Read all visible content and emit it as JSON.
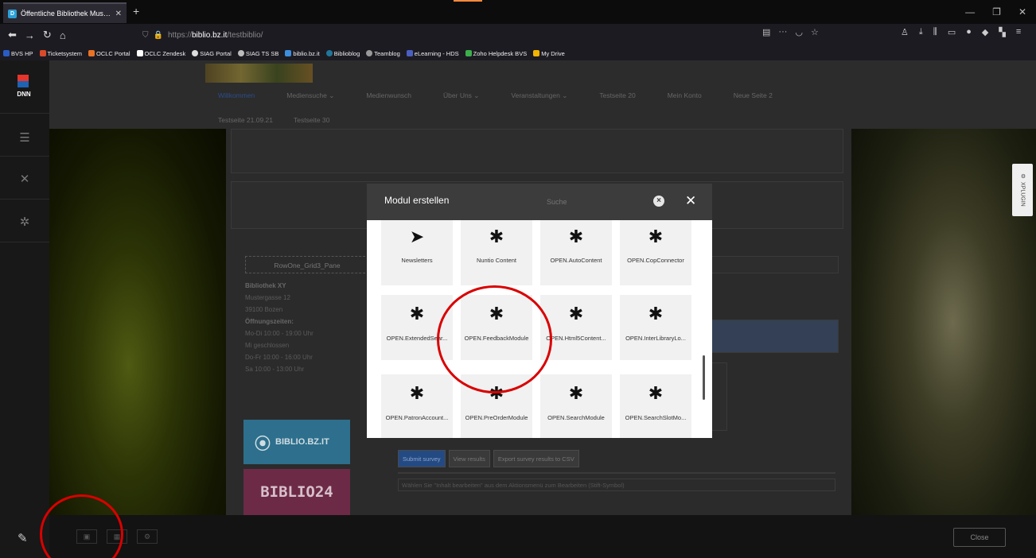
{
  "browser": {
    "tab_title": "Öffentliche Bibliothek Musterh",
    "tab_close": "✕",
    "new_tab": "+",
    "url_prefix": "https://",
    "url_domain": "biblio.bz.it",
    "url_path": "/testbiblio/",
    "page_actions": "···",
    "bookmarks": [
      "BVS HP",
      "Ticketsystem",
      "OCLC Portal",
      "OCLC Zendesk",
      "SIAG Portal",
      "SIAG TS SB",
      "biblio.bz.it",
      "Biblioblog",
      "Teamblog",
      "eLearning - HDS",
      "Zoho Helpdesk BVS",
      "My Drive"
    ],
    "window_controls": [
      "—",
      "❐",
      "✕"
    ]
  },
  "site": {
    "menu_row1": [
      "Willkommen",
      "Mediensuche ⌄",
      "Medienwunsch",
      "Über Uns ⌄",
      "Veranstaltungen ⌄",
      "Testseite 20",
      "Mein Konto",
      "Neue Seite 2"
    ],
    "menu_row2": [
      "Testseite 21.09.21",
      "Testseite 30"
    ],
    "pane_label": "RowOne_Grid3_Pane",
    "library_name": "Bibliothek XY",
    "street": "Mustergasse 12",
    "city": "39100 Bozen",
    "hours_heading": "Öffnungszeiten:",
    "hours": [
      "Mo-Di 10:00 - 19:00 Uhr",
      "Mi     geschlossen",
      "Do-Fr 10:00 - 16:00 Uhr",
      "Sa     10:00 - 13:00 Uhr"
    ],
    "biblio_bz": "BIBLIO.BZ.IT",
    "biblio24": "BIBLIO24",
    "survey_buttons": [
      "Submit survey",
      "View results",
      "Export survey results to CSV"
    ],
    "edit_hint": "Wählen Sie \"Inhalt bearbeiten\" aus dem Aktionsmenü zum Bearbeiten (Stift-Symbol)"
  },
  "dnn": {
    "logo_text": "DNN",
    "side_tab": "XPLUGIN",
    "close_button": "Close"
  },
  "modal": {
    "title": "Modul erstellen",
    "search_placeholder": "Suche",
    "modules_row1": [
      "Newsletters",
      "Nuntio Content",
      "OPEN.AutoContent",
      "OPEN.CopConnector"
    ],
    "modules_row2": [
      "OPEN.ExtendedSear...",
      "OPEN.FeedbackModule",
      "OPEN.Html5Content...",
      "OPEN.InterLibraryLo..."
    ],
    "modules_row3": [
      "OPEN.PatronAccount...",
      "OPEN.PreOrderModule",
      "OPEN.SearchModule",
      "OPEN.SearchSlotMo..."
    ],
    "icons": {
      "newsletters": "paper-plane-icon",
      "module": "puzzle-icon"
    }
  },
  "colors": {
    "annotation": "#d90000",
    "modal_header": "#3c3c3c",
    "dnn_red": "#e8352c",
    "dnn_blue": "#1e63b4"
  }
}
